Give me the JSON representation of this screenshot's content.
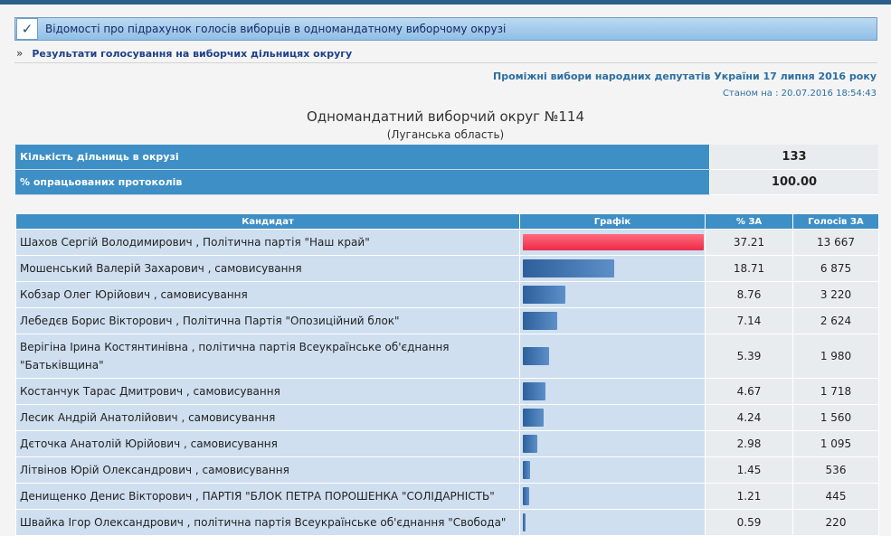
{
  "header": {
    "title": "Відомості про підрахунок голосів виборців в одномандатному виборчому окрузі"
  },
  "subnav": {
    "arrow": "»",
    "link": "Результати голосування на виборчих дільницях округу"
  },
  "election": {
    "title": "Проміжні вибори народних депутатів України 17 липня 2016 року",
    "as_of": "Станом на : 20.07.2016 18:54:43"
  },
  "district": {
    "title": "Одномандатний виборчий округ №114",
    "region": "(Луганська область)"
  },
  "stats": [
    {
      "label": "Кількість дільниць в окрузі",
      "value": "133"
    },
    {
      "label": "% опрацьованих протоколів",
      "value": "100.00"
    }
  ],
  "table": {
    "headers": {
      "candidate": "Кандидат",
      "graph": "Графік",
      "pct": "% ЗА",
      "votes": "Голосів ЗА"
    },
    "rows": [
      {
        "name": "Шахов Сергій Володимирович , Політична партія \"Наш край\"",
        "pct": "37.21",
        "votes": "13 667",
        "share": 37.21
      },
      {
        "name": "Мошенський Валерій Захарович , самовисування",
        "pct": "18.71",
        "votes": "6 875",
        "share": 18.71
      },
      {
        "name": "Кобзар Олег Юрійович , самовисування",
        "pct": "8.76",
        "votes": "3 220",
        "share": 8.76
      },
      {
        "name": "Лебедєв Борис Вікторович , Політична Партія \"Опозиційний блок\"",
        "pct": "7.14",
        "votes": "2 624",
        "share": 7.14
      },
      {
        "name": "Верігіна Ірина Костянтинівна , політична партія Всеукраїнське об'єднання \"Батьківщина\"",
        "pct": "5.39",
        "votes": "1 980",
        "share": 5.39
      },
      {
        "name": "Костанчук Тарас Дмитрович , самовисування",
        "pct": "4.67",
        "votes": "1 718",
        "share": 4.67
      },
      {
        "name": "Лесик Андрій Анатолійович , самовисування",
        "pct": "4.24",
        "votes": "1 560",
        "share": 4.24
      },
      {
        "name": "Дєточка Анатолій Юрійович , самовисування",
        "pct": "2.98",
        "votes": "1 095",
        "share": 2.98
      },
      {
        "name": "Літвінов Юрій Олександрович , самовисування",
        "pct": "1.45",
        "votes": "536",
        "share": 1.45
      },
      {
        "name": "Денищенко Денис Вікторович , ПАРТІЯ \"БЛОК ПЕТРА ПОРОШЕНКА \"СОЛІДАРНІСТЬ\"",
        "pct": "1.21",
        "votes": "445",
        "share": 1.21
      },
      {
        "name": "Швайка Ігор Олександрович , політична партія Всеукраїнське об'єднання \"Свобода\"",
        "pct": "0.59",
        "votes": "220",
        "share": 0.59
      }
    ]
  },
  "colors": {
    "header_blue": "#3d8fc6",
    "lead_bar": "#ee2a48",
    "bar": "#2d5f9c"
  }
}
